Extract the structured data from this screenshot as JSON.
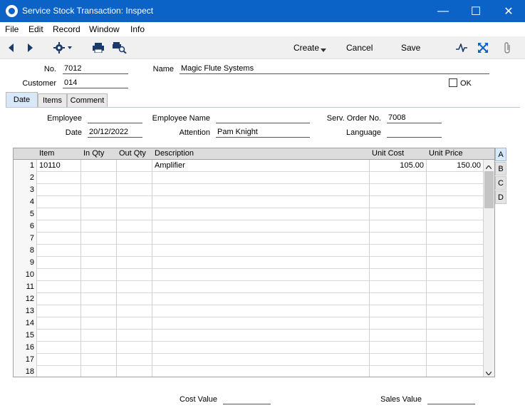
{
  "window": {
    "title": "Service Stock Transaction: Inspect",
    "controls": {
      "minimize": "—",
      "maximize": "☐",
      "close": "✕"
    }
  },
  "menu": [
    "File",
    "Edit",
    "Record",
    "Window",
    "Info"
  ],
  "toolbar": {
    "create_label": "Create",
    "cancel_label": "Cancel",
    "save_label": "Save"
  },
  "header": {
    "no_label": "No.",
    "no_value": "7012",
    "customer_label": "Customer",
    "customer_value": "014",
    "name_label": "Name",
    "name_value": "Magic Flute Systems",
    "ok_label": "OK",
    "ok_checked": false
  },
  "tabs": [
    "Date",
    "Items",
    "Comment"
  ],
  "active_tab": "Date",
  "date_tab": {
    "employee_label": "Employee",
    "employee_value": "",
    "date_label": "Date",
    "date_value": "20/12/2022",
    "employee_name_label": "Employee Name",
    "employee_name_value": "",
    "attention_label": "Attention",
    "attention_value": "Pam Knight",
    "serv_order_label": "Serv. Order No.",
    "serv_order_value": "7008",
    "language_label": "Language",
    "language_value": ""
  },
  "grid": {
    "columns": [
      "Item",
      "In Qty",
      "Out Qty",
      "Description",
      "Unit Cost",
      "Unit Price"
    ],
    "rows": [
      {
        "n": "1",
        "item": "10110",
        "in_qty": "",
        "out_qty": "",
        "description": "Amplifier",
        "unit_cost": "105.00",
        "unit_price": "150.00"
      },
      {
        "n": "2"
      },
      {
        "n": "3"
      },
      {
        "n": "4"
      },
      {
        "n": "5"
      },
      {
        "n": "6"
      },
      {
        "n": "7"
      },
      {
        "n": "8"
      },
      {
        "n": "9"
      },
      {
        "n": "10"
      },
      {
        "n": "11"
      },
      {
        "n": "12"
      },
      {
        "n": "13"
      },
      {
        "n": "14"
      },
      {
        "n": "15"
      },
      {
        "n": "16"
      },
      {
        "n": "17"
      },
      {
        "n": "18"
      }
    ],
    "side_tabs": [
      "A",
      "B",
      "C",
      "D"
    ],
    "active_side_tab": "A"
  },
  "footer": {
    "cost_value_label": "Cost Value",
    "cost_value": "",
    "sales_value_label": "Sales Value",
    "sales_value": ""
  },
  "colors": {
    "titlebar": "#0b63c8",
    "active_tab": "#d8e8f8"
  }
}
